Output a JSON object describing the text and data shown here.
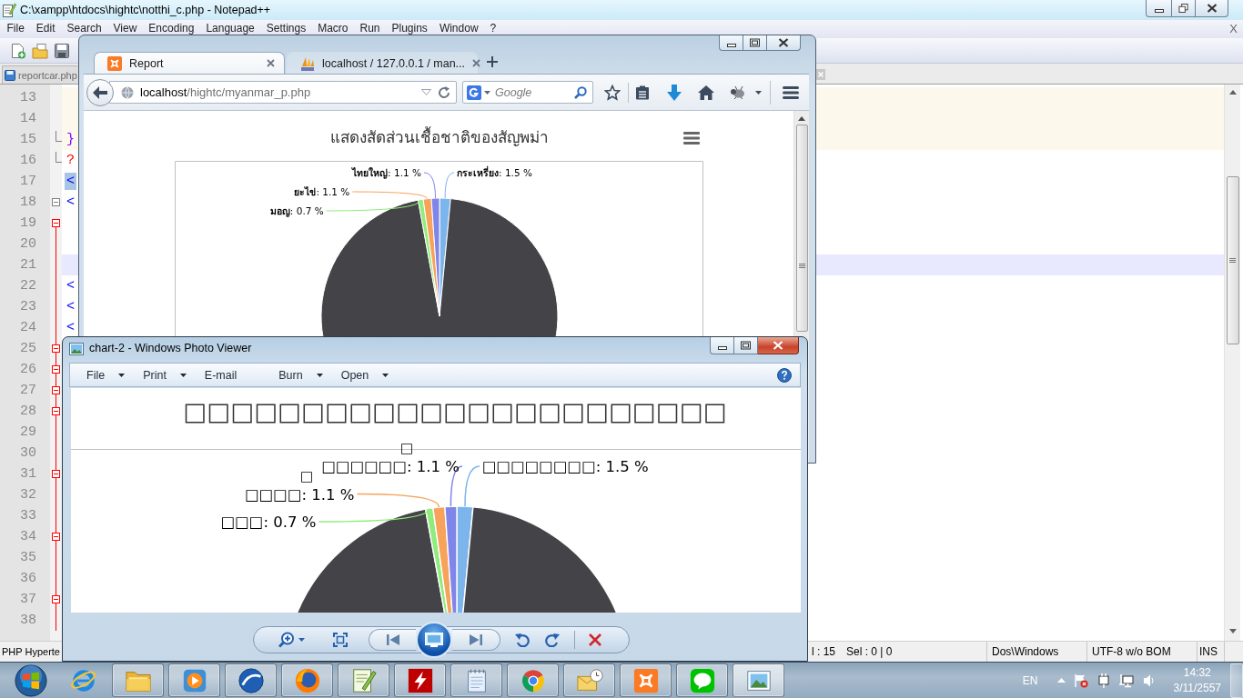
{
  "notepad": {
    "title": "C:\\xampp\\htdocs\\hightc\\notthi_c.php - Notepad++",
    "menu": [
      "File",
      "Edit",
      "Search",
      "View",
      "Encoding",
      "Language",
      "Settings",
      "Macro",
      "Run",
      "Plugins",
      "Window",
      "?"
    ],
    "close_document": "X",
    "tabs": [
      {
        "label": "reportcar.php",
        "selected": false
      }
    ],
    "lines": [
      {
        "number": "13",
        "kind": "plain",
        "shaded": true,
        "current": false,
        "in_block": false
      },
      {
        "number": "14",
        "kind": "plain",
        "shaded": true,
        "current": false,
        "in_block": false
      },
      {
        "number": "15",
        "kind": "fold-end",
        "shaded": true,
        "current": false,
        "in_block": false,
        "code": {
          "text": "}",
          "kind": "bracket",
          "selected": false
        }
      },
      {
        "number": "16",
        "kind": "fold-end",
        "shaded": false,
        "current": false,
        "in_block": false,
        "code": {
          "text": "?",
          "kind": "php",
          "selected": false
        }
      },
      {
        "number": "17",
        "kind": "plain",
        "shaded": false,
        "current": false,
        "in_block": false,
        "code": {
          "text": "<",
          "kind": "tag",
          "selected": true
        }
      },
      {
        "number": "18",
        "kind": "fold-open",
        "shaded": false,
        "current": false,
        "in_block": false,
        "code": {
          "text": "<",
          "kind": "tag",
          "selected": false
        }
      },
      {
        "number": "19",
        "kind": "fold-open",
        "shaded": false,
        "current": false,
        "in_block": true
      },
      {
        "number": "20",
        "kind": "plain",
        "shaded": false,
        "current": false,
        "in_block": true
      },
      {
        "number": "21",
        "kind": "plain",
        "shaded": false,
        "current": true,
        "in_block": true
      },
      {
        "number": "22",
        "kind": "plain",
        "shaded": false,
        "current": false,
        "in_block": true,
        "code": {
          "text": "<",
          "kind": "tag",
          "selected": false
        }
      },
      {
        "number": "23",
        "kind": "plain",
        "shaded": false,
        "current": false,
        "in_block": true,
        "code": {
          "text": "<",
          "kind": "tag",
          "selected": false
        }
      },
      {
        "number": "24",
        "kind": "plain",
        "shaded": false,
        "current": false,
        "in_block": true,
        "code": {
          "text": "<",
          "kind": "tag",
          "selected": false
        }
      },
      {
        "number": "25",
        "kind": "fold-open",
        "shaded": false,
        "current": false,
        "in_block": true
      },
      {
        "number": "26",
        "kind": "fold-open",
        "shaded": false,
        "current": false,
        "in_block": true
      },
      {
        "number": "27",
        "kind": "fold-open",
        "shaded": false,
        "current": false,
        "in_block": true
      },
      {
        "number": "28",
        "kind": "fold-open",
        "shaded": false,
        "current": false,
        "in_block": true
      },
      {
        "number": "29",
        "kind": "plain",
        "shaded": false,
        "current": false,
        "in_block": true
      },
      {
        "number": "30",
        "kind": "plain",
        "shaded": false,
        "current": false,
        "in_block": true
      },
      {
        "number": "31",
        "kind": "fold-open",
        "shaded": false,
        "current": false,
        "in_block": true
      },
      {
        "number": "32",
        "kind": "plain",
        "shaded": false,
        "current": false,
        "in_block": true
      },
      {
        "number": "33",
        "kind": "plain",
        "shaded": false,
        "current": false,
        "in_block": true
      },
      {
        "number": "34",
        "kind": "fold-open",
        "shaded": false,
        "current": false,
        "in_block": true
      },
      {
        "number": "35",
        "kind": "plain",
        "shaded": false,
        "current": false,
        "in_block": true
      },
      {
        "number": "36",
        "kind": "plain",
        "shaded": false,
        "current": false,
        "in_block": true
      },
      {
        "number": "37",
        "kind": "fold-open",
        "shaded": false,
        "current": false,
        "in_block": true
      },
      {
        "number": "38",
        "kind": "plain",
        "shaded": false,
        "current": false,
        "in_block": true
      }
    ],
    "status": {
      "file_type": "PHP Hyperte",
      "column": "l : 15",
      "selection": "Sel : 0 | 0",
      "line_ending": "Dos\\Windows",
      "encoding": "UTF-8 w/o BOM",
      "mode": "INS"
    }
  },
  "firefox": {
    "tabs": [
      {
        "label": "Report",
        "selected": true
      },
      {
        "label": "localhost / 127.0.0.1 / man...",
        "selected": false
      }
    ],
    "address": {
      "host": "localhost",
      "path": "/hightc/myanmar_p.php"
    },
    "search": {
      "placeholder": "Google"
    },
    "page": {
      "chart_data": {
        "type": "pie",
        "title": "แสดงสัดส่วนเชื้อชาติของสัญพม่า",
        "categories": [
          "กระเหรี่ยง",
          null,
          "มอญ",
          "ยะไข่",
          "ไทยใหญ่"
        ],
        "values": [
          1.5,
          95.6,
          0.7,
          1.1,
          1.1
        ],
        "colors": [
          "#7cb5ec",
          "#434348",
          "#90ed7d",
          "#f7a35c",
          "#8085e9"
        ],
        "value_labels": [
          ": 1.5 %",
          null,
          ": 0.7 %",
          ": 1.1 %",
          ": 1.1 %"
        ]
      }
    }
  },
  "photo_viewer": {
    "title": "chart-2 - Windows Photo Viewer",
    "menu": [
      {
        "label": "File",
        "dropdown": true
      },
      {
        "label": "Print",
        "dropdown": true
      },
      {
        "label": "E-mail",
        "dropdown": false
      },
      {
        "label": "Burn",
        "dropdown": true
      },
      {
        "label": "Open",
        "dropdown": true
      }
    ],
    "image": {
      "chart_data": {
        "type": "pie",
        "title": "□□□□□□□□□□□□□□□□□□□□□□□",
        "categories": [
          "□□□□□□□□",
          null,
          "□□□",
          "□□□□",
          "□□□□□□"
        ],
        "values": [
          1.5,
          95.6,
          0.7,
          1.1,
          1.1
        ],
        "colors": [
          "#7cb5ec",
          "#434348",
          "#90ed7d",
          "#f7a35c",
          "#8085e9"
        ],
        "value_labels": [
          ": 1.5 %",
          null,
          ": 0.7 %",
          ": 1.1 %",
          ": 1.1 %"
        ],
        "annotations": [
          {
            "text": "□"
          },
          {
            "text": "□"
          }
        ]
      }
    }
  },
  "taskbar": {
    "apps": [
      {
        "running": false,
        "selected": false
      },
      {
        "running": true,
        "selected": false
      },
      {
        "running": true,
        "selected": false
      },
      {
        "running": true,
        "selected": false
      },
      {
        "running": true,
        "selected": false
      },
      {
        "running": true,
        "selected": false
      },
      {
        "running": true,
        "selected": false
      },
      {
        "running": true,
        "selected": false
      },
      {
        "running": true,
        "selected": false
      },
      {
        "running": true,
        "selected": false
      },
      {
        "running": true,
        "selected": false
      },
      {
        "running": true,
        "selected": false
      },
      {
        "running": true,
        "selected": true
      }
    ],
    "language": "EN",
    "time": "14:32",
    "date": "3/11/2557"
  }
}
